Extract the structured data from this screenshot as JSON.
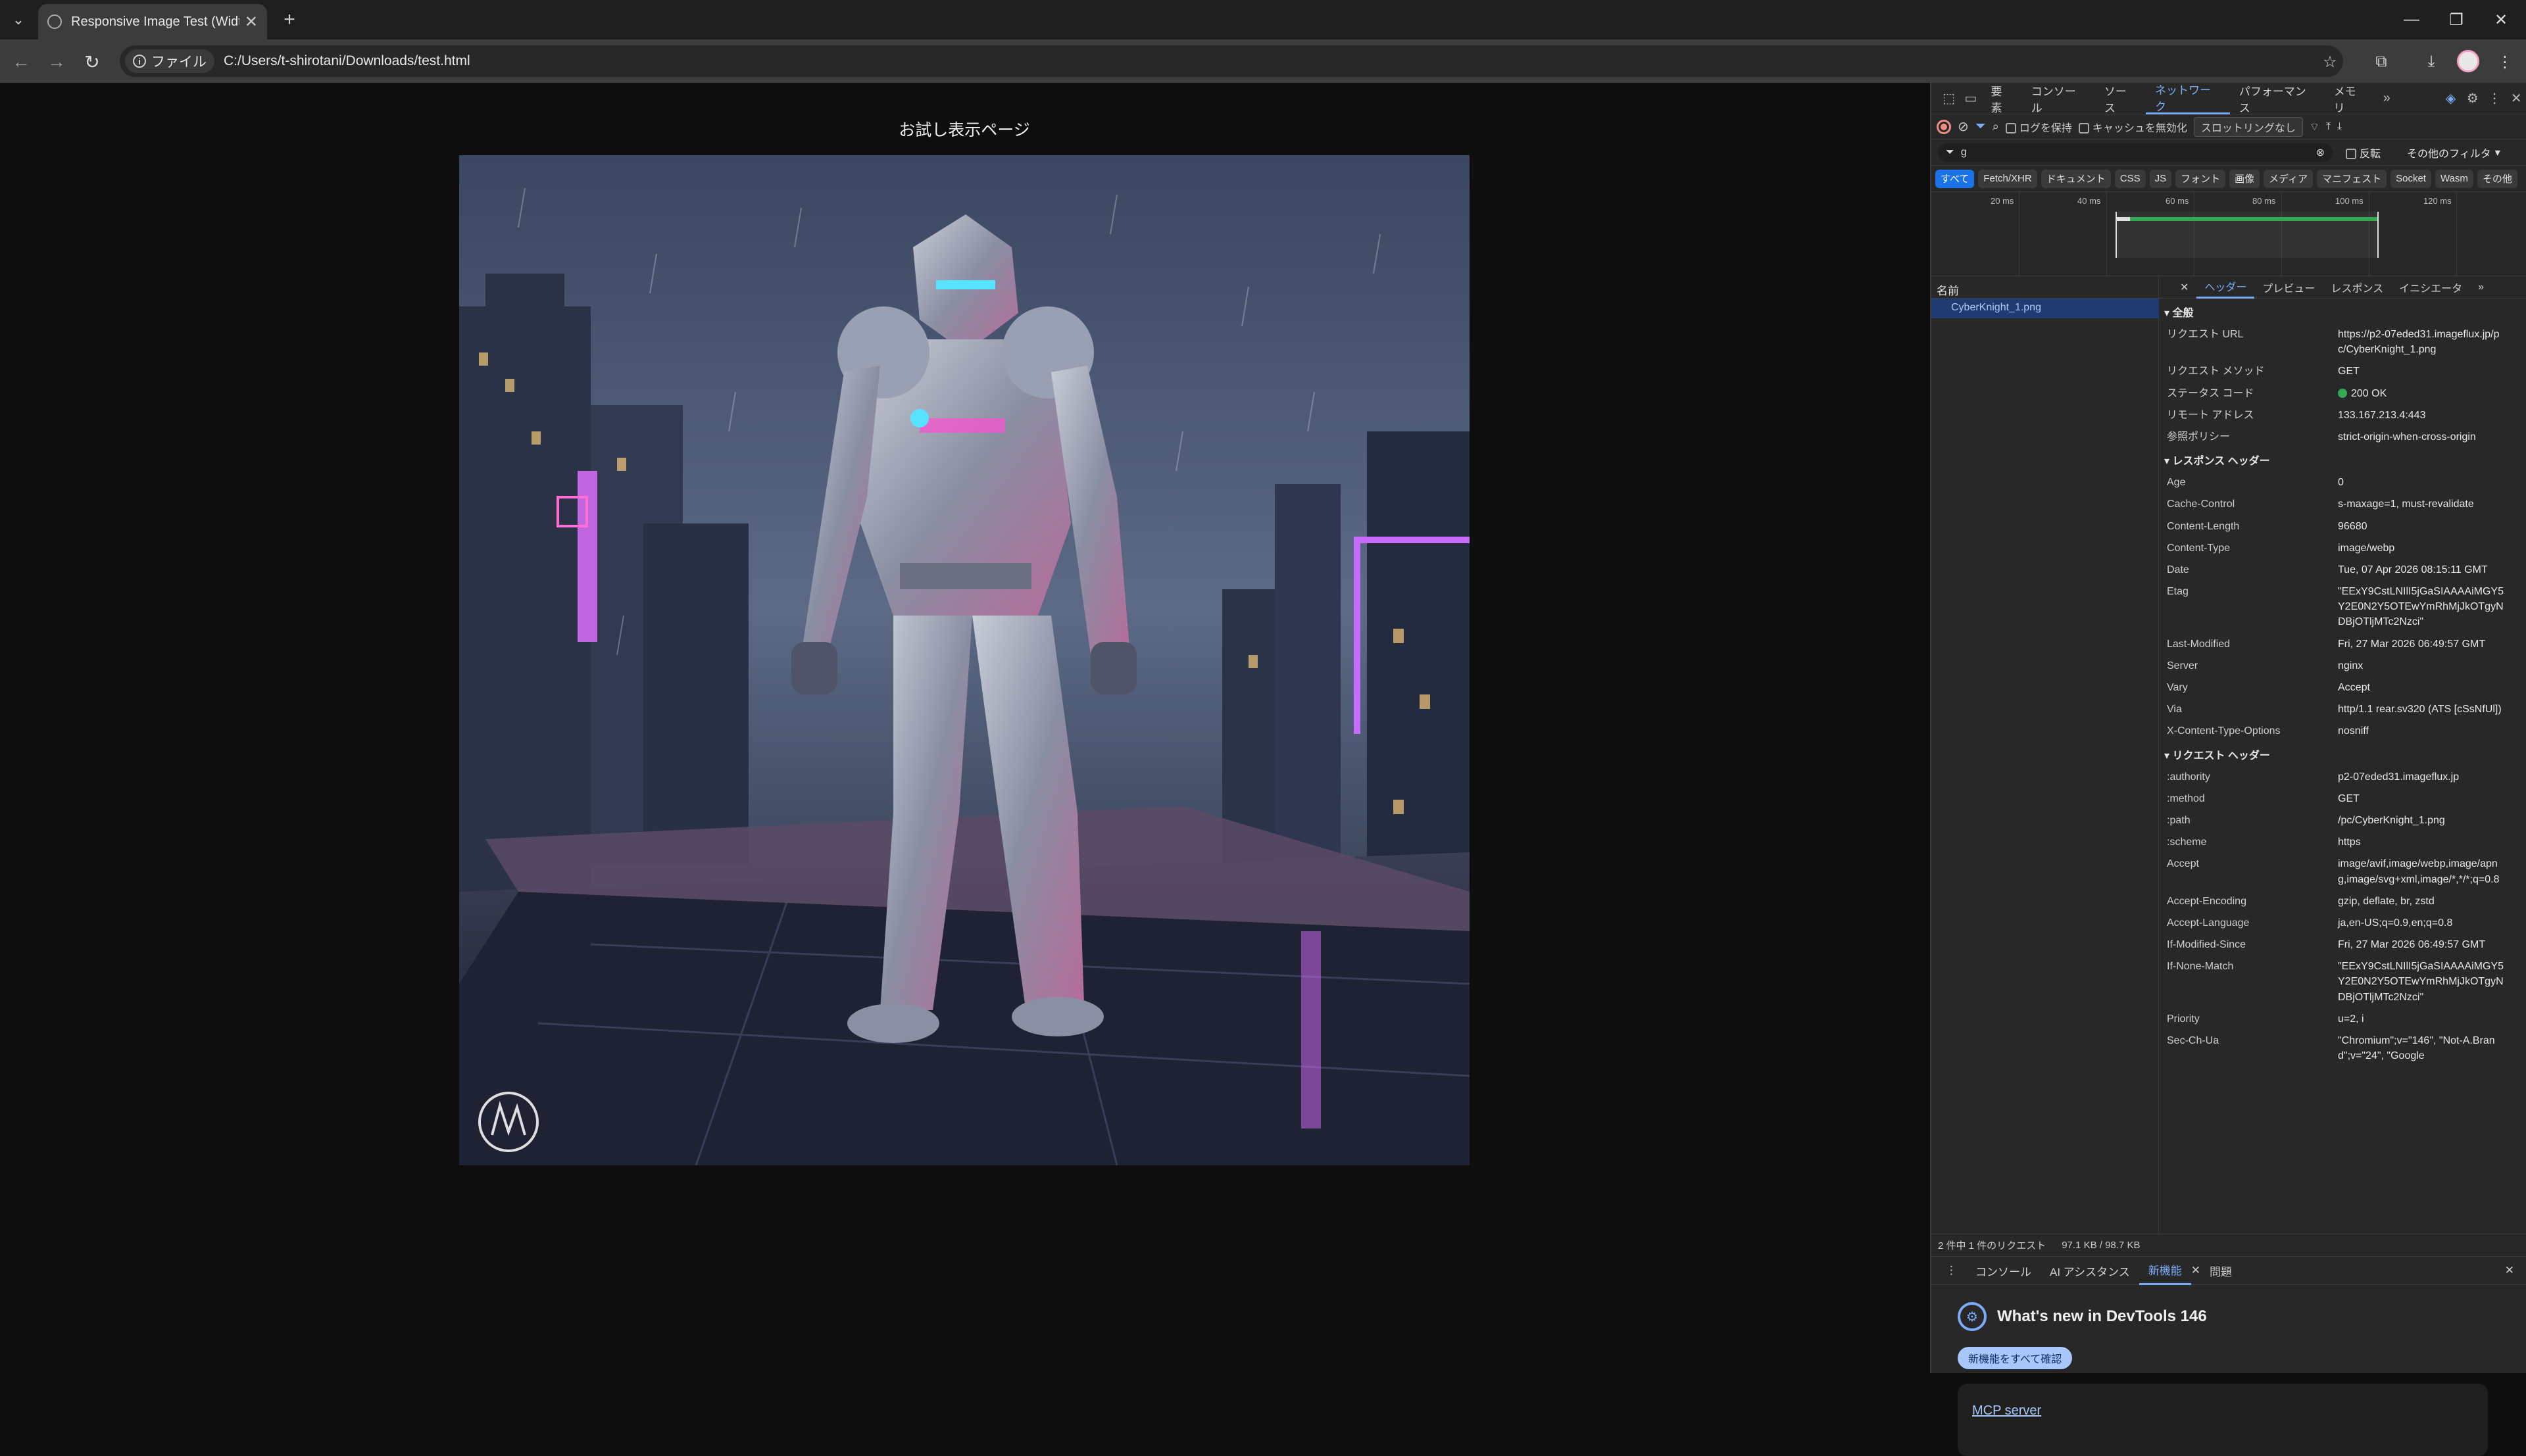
{
  "browser": {
    "tab_title": "Responsive Image Test (Width",
    "new_tab": "+",
    "address_chip": "ファイル",
    "url": "C:/Users/t-shirotani/Downloads/test.html"
  },
  "page": {
    "title": "お試し表示ページ",
    "image_alt": "CyberKnight_1.png"
  },
  "devtools": {
    "tabs": [
      "要素",
      "コンソール",
      "ソース",
      "ネットワーク",
      "パフォーマンス",
      "メモリ"
    ],
    "active_tab": "ネットワーク",
    "toolbar": {
      "preserve_log": "ログを保持",
      "disable_cache": "キャッシュを無効化",
      "throttling": "スロットリングなし"
    },
    "filter": {
      "value": "g",
      "invert": "反転",
      "more_filters": "その他のフィルタ"
    },
    "type_filters": [
      "すべて",
      "Fetch/XHR",
      "ドキュメント",
      "CSS",
      "JS",
      "フォント",
      "画像",
      "メディア",
      "マニフェスト",
      "Socket",
      "Wasm",
      "その他"
    ],
    "timeline_ticks": [
      "20 ms",
      "40 ms",
      "60 ms",
      "80 ms",
      "100 ms",
      "120 ms"
    ],
    "request_list_header": "名前",
    "request_name": "CyberKnight_1.png",
    "detail_tabs": [
      "ヘッダー",
      "プレビュー",
      "レスポンス",
      "イニシエータ"
    ],
    "general_title": "▾ 全般",
    "general": [
      {
        "k": "リクエスト URL",
        "v": "https://p2-07eded31.imageflux.jp/pc/CyberKnight_1.png"
      },
      {
        "k": "リクエスト メソッド",
        "v": "GET"
      },
      {
        "k": "ステータス コード",
        "v": "200 OK"
      },
      {
        "k": "リモート アドレス",
        "v": "133.167.213.4:443"
      },
      {
        "k": "参照ポリシー",
        "v": "strict-origin-when-cross-origin"
      }
    ],
    "response_title": "▾ レスポンス ヘッダー",
    "response_headers": [
      {
        "k": "Age",
        "v": "0"
      },
      {
        "k": "Cache-Control",
        "v": "s-maxage=1, must-revalidate"
      },
      {
        "k": "Content-Length",
        "v": "96680"
      },
      {
        "k": "Content-Type",
        "v": "image/webp"
      },
      {
        "k": "Date",
        "v": "Tue, 07 Apr 2026 08:15:11 GMT"
      },
      {
        "k": "Etag",
        "v": "\"EExY9CstLNIlI5jGaSIAAAAiMGY5Y2E0N2Y5OTEwYmRhMjJkOTgyNDBjOTljMTc2Nzci\""
      },
      {
        "k": "Last-Modified",
        "v": "Fri, 27 Mar 2026 06:49:57 GMT"
      },
      {
        "k": "Server",
        "v": "nginx"
      },
      {
        "k": "Vary",
        "v": "Accept"
      },
      {
        "k": "Via",
        "v": "http/1.1 rear.sv320 (ATS [cSsNfUl])"
      },
      {
        "k": "X-Content-Type-Options",
        "v": "nosniff"
      }
    ],
    "request_title": "▾ リクエスト ヘッダー",
    "request_headers": [
      {
        "k": ":authority",
        "v": "p2-07eded31.imageflux.jp"
      },
      {
        "k": ":method",
        "v": "GET"
      },
      {
        "k": ":path",
        "v": "/pc/CyberKnight_1.png"
      },
      {
        "k": ":scheme",
        "v": "https"
      },
      {
        "k": "Accept",
        "v": "image/avif,image/webp,image/apng,image/svg+xml,image/*,*/*;q=0.8"
      },
      {
        "k": "Accept-Encoding",
        "v": "gzip, deflate, br, zstd"
      },
      {
        "k": "Accept-Language",
        "v": "ja,en-US;q=0.9,en;q=0.8"
      },
      {
        "k": "If-Modified-Since",
        "v": "Fri, 27 Mar 2026 06:49:57 GMT"
      },
      {
        "k": "If-None-Match",
        "v": "\"EExY9CstLNIlI5jGaSIAAAAiMGY5Y2E0N2Y5OTEwYmRhMjJkOTgyNDBjOTljMTc2Nzci\""
      },
      {
        "k": "Priority",
        "v": "u=2, i"
      },
      {
        "k": "Sec-Ch-Ua",
        "v": "\"Chromium\";v=\"146\", \"Not-A.Brand\";v=\"24\", \"Google"
      }
    ],
    "status": {
      "requests": "2 件中 1 件のリクエスト",
      "transferred": "97.1 KB / 98.7 KB"
    },
    "drawer_tabs": [
      "コンソール",
      "AI アシスタンス",
      "新機能",
      "問題"
    ],
    "whats_new": "What's new in DevTools 146",
    "see_all": "新機能をすべて確認",
    "mcp": "MCP server"
  },
  "colors": {
    "accent": "#7cacf8",
    "selected_row": "#1f3b6f",
    "status_ok": "#34a853"
  }
}
